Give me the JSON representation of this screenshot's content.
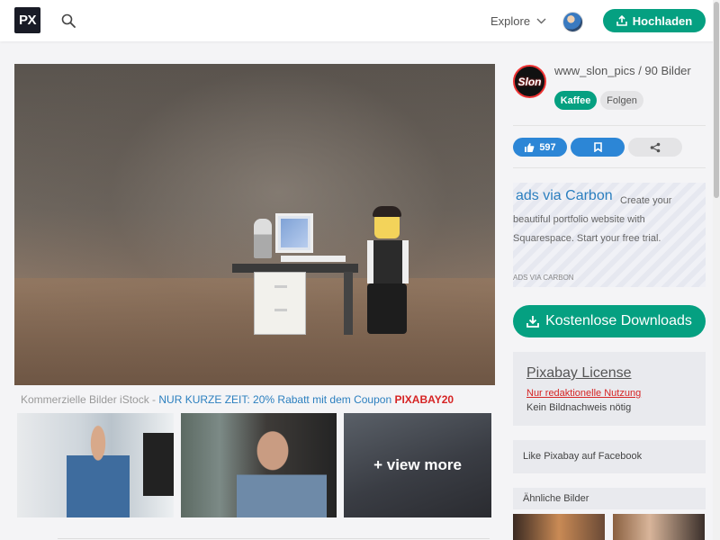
{
  "header": {
    "logo_text": "PX",
    "explore_label": "Explore",
    "upload_label": "Hochladen"
  },
  "main": {
    "caption_prefix": "Kommerzielle Bilder iStock - ",
    "caption_promo": "NUR KURZE ZEIT: 20% Rabatt mit dem Coupon ",
    "caption_coupon": "PIXABAY20",
    "view_more_label": "+ view more"
  },
  "sidebar": {
    "avatar_text": "Slon",
    "author_line": "www_slon_pics / 90 Bilder",
    "kaffee_label": "Kaffee",
    "folgen_label": "Folgen",
    "likes_count": "597",
    "carbon_brand": "ads via Carbon",
    "carbon_text": "Create your beautiful portfolio website with Squarespace. Start your free trial.",
    "carbon_ads_label": "ADS VIA CARBON",
    "download_label": "Kostenlose Downloads",
    "license_title": "Pixabay License",
    "license_usage": "Nur redaktionelle Nutzung",
    "license_note": "Kein Bildnachweis nötig",
    "facebook_label": "Like Pixabay auf Facebook",
    "similar_label": "Ähnliche Bilder"
  },
  "colors": {
    "brand_green": "#05a081",
    "action_blue": "#2c86d6",
    "coupon_red": "#d62424",
    "link_blue": "#2b7fbf"
  }
}
